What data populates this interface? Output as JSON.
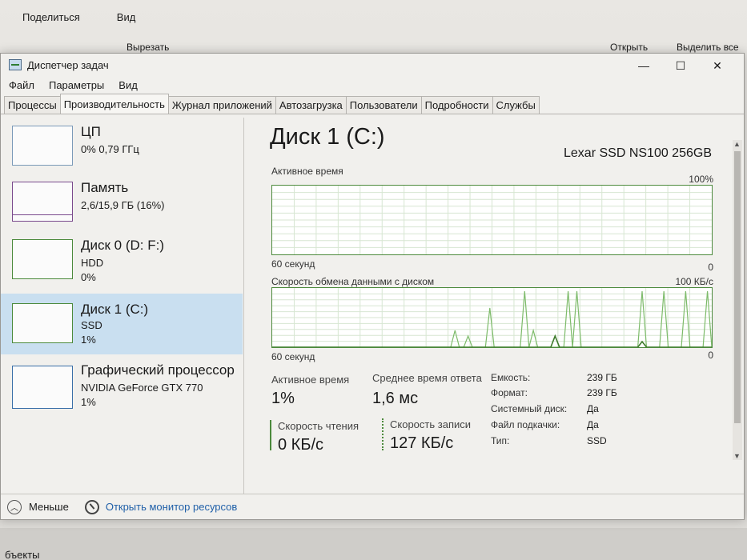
{
  "background": {
    "menu": [
      "Поделиться",
      "Вид"
    ],
    "ribbon_left": "Вырезать",
    "ribbon_open": "Открыть",
    "ribbon_select": "Выделить все",
    "bottom_text": "бъекты"
  },
  "window": {
    "title": "Диспетчер задач",
    "minimize": "—",
    "maximize": "☐",
    "close": "✕"
  },
  "menubar": [
    "Файл",
    "Параметры",
    "Вид"
  ],
  "tabs": [
    "Процессы",
    "Производительность",
    "Журнал приложений",
    "Автозагрузка",
    "Пользователи",
    "Подробности",
    "Службы"
  ],
  "active_tab": "Производительность",
  "sidebar": {
    "items": [
      {
        "title": "ЦП",
        "line1": "0% 0,79 ГГц",
        "line2": ""
      },
      {
        "title": "Память",
        "line1": "2,6/15,9 ГБ (16%)",
        "line2": ""
      },
      {
        "title": "Диск 0 (D: F:)",
        "line1": "HDD",
        "line2": "0%"
      },
      {
        "title": "Диск 1 (C:)",
        "line1": "SSD",
        "line2": "1%"
      },
      {
        "title": "Графический процессор",
        "line1": "NVIDIA GeForce GTX 770",
        "line2": "1%"
      }
    ]
  },
  "main": {
    "title": "Диск 1 (C:)",
    "model": "Lexar SSD NS100 256GB",
    "graph1": {
      "label": "Активное время",
      "max": "100%",
      "time": "60 секунд",
      "min": "0"
    },
    "graph2": {
      "label": "Скорость обмена данными с диском",
      "max": "100 КБ/с",
      "time": "60 секунд",
      "min": "0"
    },
    "stats": {
      "active_label": "Активное время",
      "active_value": "1%",
      "resp_label": "Среднее время ответа",
      "resp_value": "1,6 мс",
      "read_label": "Скорость чтения",
      "read_value": "0 КБ/с",
      "write_label": "Скорость записи",
      "write_value": "127 КБ/с"
    },
    "properties": [
      {
        "key": "Емкость:",
        "value": "239 ГБ"
      },
      {
        "key": "Формат:",
        "value": "239 ГБ"
      },
      {
        "key": "Системный диск:",
        "value": "Да"
      },
      {
        "key": "Файл подкачки:",
        "value": "Да"
      },
      {
        "key": "Тип:",
        "value": "SSD"
      }
    ]
  },
  "footer": {
    "less": "Меньше",
    "monitor": "Открыть монитор ресурсов"
  },
  "chart_data": {
    "type": "line",
    "series": [
      {
        "values": [
          0,
          0,
          0,
          0,
          0,
          0,
          0,
          0,
          0,
          0,
          0,
          0,
          0,
          0,
          0,
          0,
          0,
          0,
          0,
          0,
          0,
          0,
          0,
          0,
          0,
          0,
          0,
          0,
          0,
          0,
          0,
          0,
          0,
          0,
          0,
          0,
          0,
          0,
          0,
          0,
          0,
          0,
          30,
          0,
          0,
          20,
          0,
          0,
          0,
          0,
          70,
          0,
          0,
          0,
          0,
          0,
          0,
          0,
          100,
          0,
          30,
          0,
          0,
          0,
          0,
          0,
          0,
          0,
          100,
          0,
          100,
          0,
          0,
          0,
          0,
          0,
          0,
          0,
          0,
          0,
          0,
          0,
          0,
          0,
          0,
          100,
          0,
          0,
          0,
          0,
          100,
          0,
          0,
          0,
          0,
          100,
          0,
          0,
          0,
          0,
          100,
          0
        ]
      },
      {
        "values": [
          0,
          0,
          0,
          0,
          0,
          0,
          0,
          0,
          0,
          0,
          0,
          0,
          0,
          0,
          0,
          0,
          0,
          0,
          0,
          0,
          0,
          0,
          0,
          0,
          0,
          0,
          0,
          0,
          0,
          0,
          0,
          0,
          0,
          0,
          0,
          0,
          0,
          0,
          0,
          0,
          0,
          0,
          0,
          0,
          0,
          0,
          0,
          0,
          0,
          0,
          0,
          0,
          0,
          0,
          0,
          0,
          0,
          0,
          0,
          0,
          0,
          0,
          0,
          0,
          0,
          20,
          0,
          0,
          0,
          0,
          0,
          0,
          0,
          0,
          0,
          0,
          0,
          0,
          0,
          0,
          0,
          0,
          0,
          0,
          0,
          10,
          0,
          0,
          0,
          0,
          0,
          0,
          0,
          0,
          0,
          0,
          0,
          0,
          0,
          0,
          0,
          0
        ]
      }
    ],
    "ylim": [
      0,
      100
    ]
  }
}
